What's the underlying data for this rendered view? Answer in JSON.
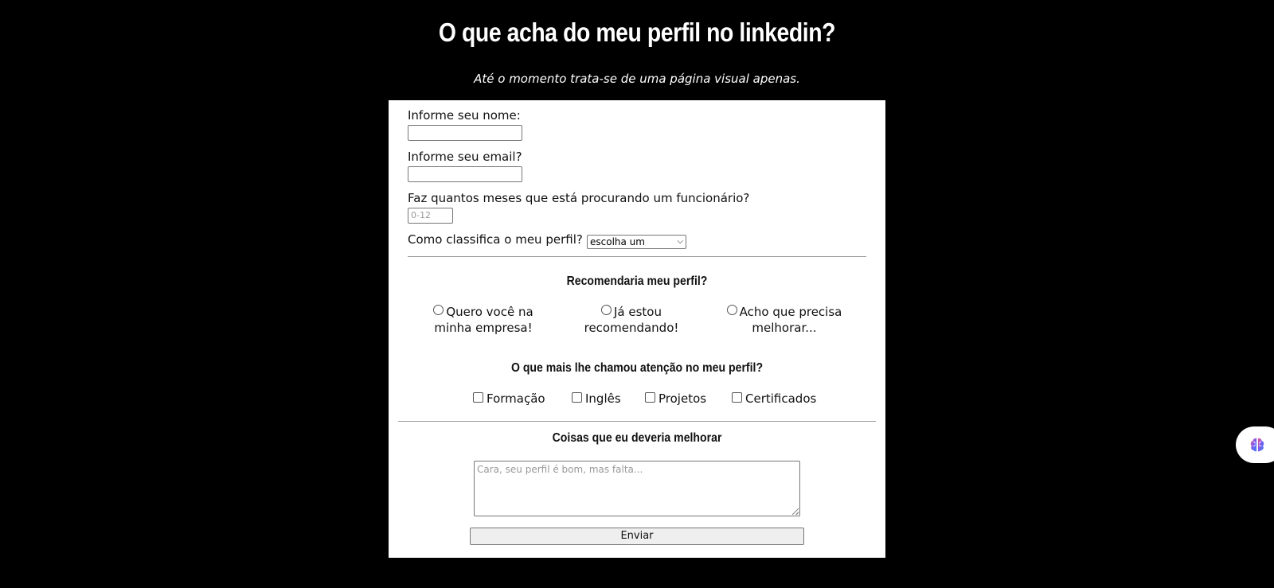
{
  "header": {
    "title": "O que acha do meu perfil no linkedin?",
    "subtitle": "Até o momento trata-se de uma página visual apenas."
  },
  "form": {
    "name_label": "Informe seu nome:",
    "name_value": "",
    "email_label": "Informe seu email?",
    "email_value": "",
    "months_label": "Faz quantos meses que está procurando um funcionário?",
    "months_placeholder": "0-12",
    "rating_label": "Como classifica o meu perfil?",
    "rating_selected": "escolha um",
    "recommend": {
      "title": "Recomendaria meu perfil?",
      "options": [
        {
          "line1": "Quero você na",
          "line2": "minha empresa!"
        },
        {
          "line1": "Já estou",
          "line2": "recomendando!"
        },
        {
          "line1": "Acho que precisa",
          "line2": "melhorar..."
        }
      ]
    },
    "attention": {
      "title": "O que mais lhe chamou atenção no meu perfil?",
      "options": [
        "Formação",
        "Inglês",
        "Projetos",
        "Certificados"
      ]
    },
    "improve": {
      "title": "Coisas que eu deveria melhorar",
      "placeholder": "Cara, seu perfil é bom, mas falta..."
    },
    "submit_label": "Enviar"
  },
  "extension": {
    "icon": "brain-icon",
    "colors": [
      "#f0508c",
      "#7a5cf0",
      "#3b82f6"
    ]
  }
}
